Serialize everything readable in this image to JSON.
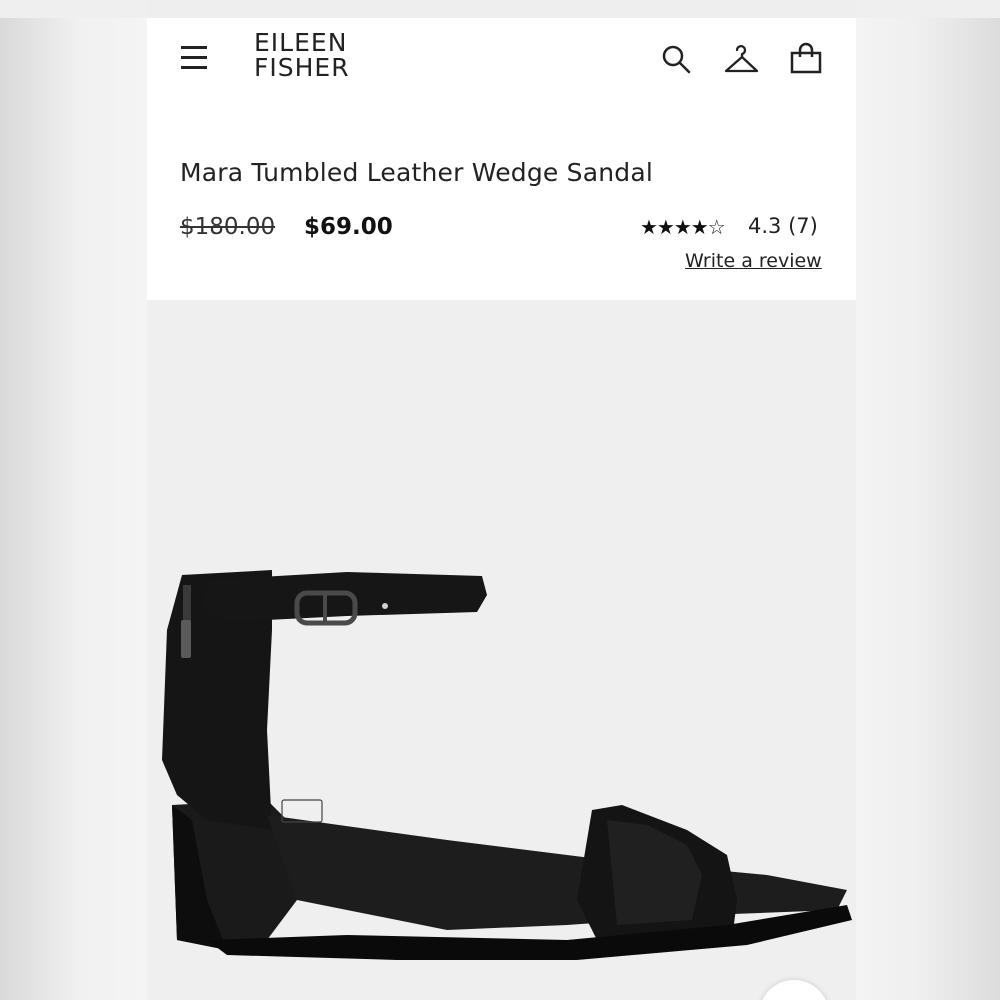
{
  "brand": {
    "line1": "EILEEN",
    "line2": "FISHER"
  },
  "header_icons": [
    "menu-icon",
    "search-icon",
    "wishlist-hanger-icon",
    "bag-icon"
  ],
  "product": {
    "title": "Mara Tumbled Leather Wedge Sandal",
    "original_price": "$180.00",
    "sale_price": "$69.00",
    "rating": {
      "stars_text": "★★★★☆",
      "value": 4.3,
      "value_label": "4.3",
      "count_label": "(7)"
    },
    "write_review_label": "Write a review"
  },
  "gallery": {
    "image_subject": "black-wedge-sandal-product-photo",
    "colors": {
      "background": "#efefef",
      "shoe": "#141414"
    }
  }
}
